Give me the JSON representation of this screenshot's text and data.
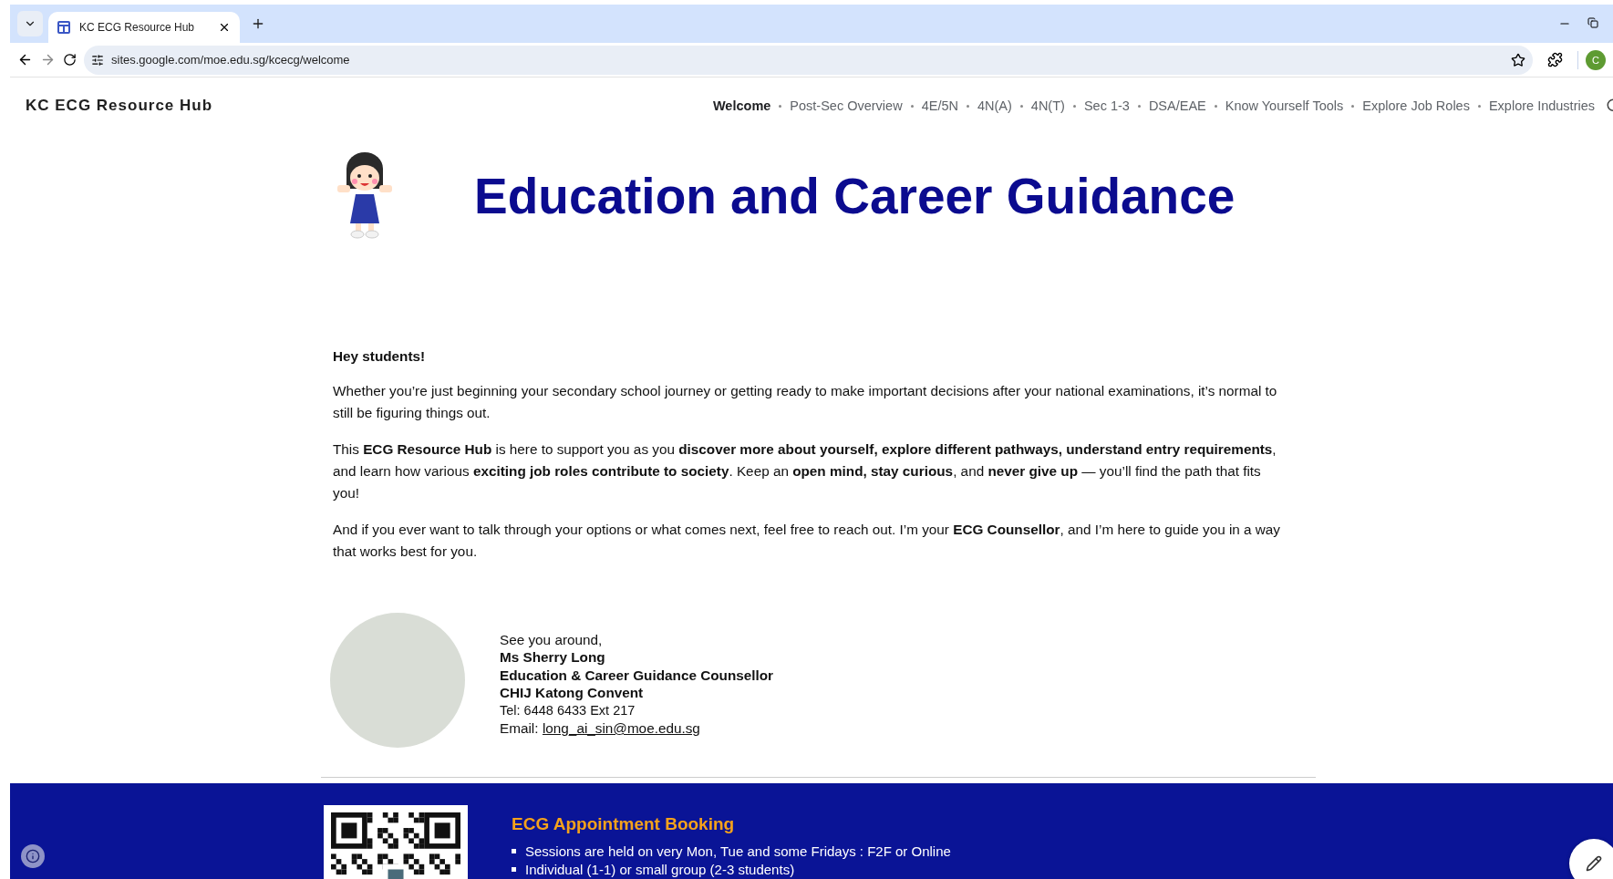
{
  "browser": {
    "tab_title": "KC ECG Resource Hub",
    "url": "sites.google.com/moe.edu.sg/kcecg/welcome",
    "profile_initial": "C"
  },
  "site": {
    "title": "KC ECG Resource Hub",
    "nav": [
      {
        "label": "Welcome",
        "selected": true
      },
      {
        "label": "Post-Sec Overview",
        "selected": false
      },
      {
        "label": "4E/5N",
        "selected": false
      },
      {
        "label": "4N(A)",
        "selected": false
      },
      {
        "label": "4N(T)",
        "selected": false
      },
      {
        "label": "Sec 1-3",
        "selected": false
      },
      {
        "label": "DSA/EAE",
        "selected": false
      },
      {
        "label": "Know Yourself Tools",
        "selected": false
      },
      {
        "label": "Explore Job Roles",
        "selected": false
      },
      {
        "label": "Explore Industries",
        "selected": false
      }
    ]
  },
  "hero": {
    "title": "Education and Career Guidance"
  },
  "intro": {
    "greeting": "Hey students!",
    "paragraphs": [
      "Whether you’re just beginning your secondary school journey or getting ready to make important decisions after your national examinations, it’s normal to still be figuring things out.",
      "This **ECG Resource Hub** is here to support you as you **discover more about yourself, explore different pathways, understand entry requirements**, and learn how various **exciting job roles contribute to society**. Keep an **open mind, stay curious**, and **never give up** — you’ll find the path that fits you!",
      "And if you ever want to talk through your options or what comes next, feel free to reach out. I’m your **ECG Counsellor**, and I’m here to guide you in a way that works best for you."
    ]
  },
  "signature": {
    "lines": [
      {
        "kind": "plain",
        "text": "See you around,"
      },
      {
        "kind": "bold",
        "text": "Ms Sherry Long"
      },
      {
        "kind": "bold",
        "text": "Education & Career Guidance Counsellor"
      },
      {
        "kind": "bold",
        "text": "CHIJ Katong Convent"
      },
      {
        "kind": "phone",
        "text": "Tel: 6448 6433 Ext 217"
      },
      {
        "kind": "email",
        "text": "Email:",
        "link": "long_ai_sin@moe.edu.sg"
      }
    ]
  },
  "booking": {
    "title": "ECG Appointment Booking",
    "items": [
      "Sessions are held on very Mon, Tue and some Fridays : F2F or Online",
      "Individual (1-1) or small group (2-3 students)"
    ]
  }
}
